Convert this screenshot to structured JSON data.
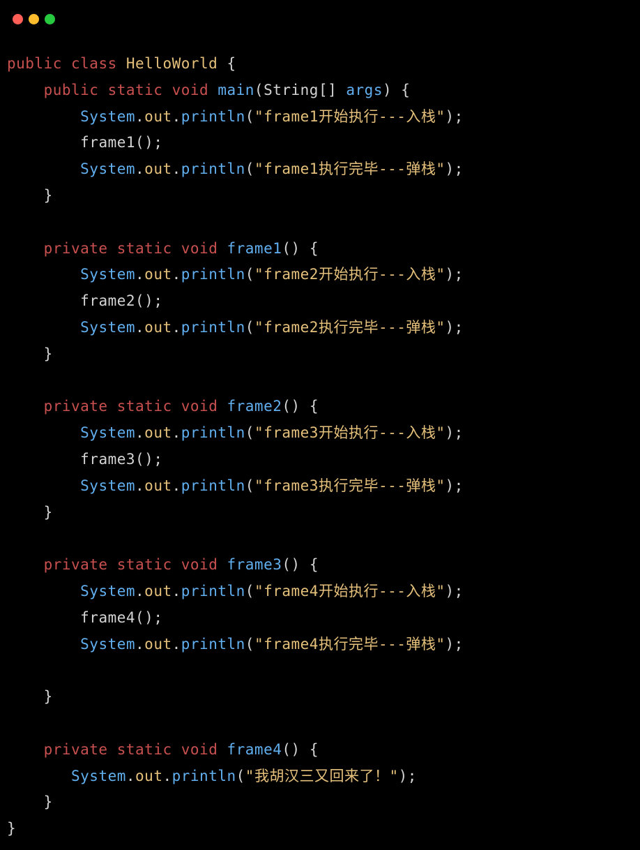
{
  "window": {
    "dots": [
      "red",
      "yellow",
      "green"
    ]
  },
  "tokens": {
    "public": "public",
    "private": "private",
    "class": "class",
    "static": "static",
    "void": "void",
    "className": "HelloWorld",
    "main": "main",
    "String": "String",
    "brackets": "[]",
    "args": "args",
    "System": "System",
    "out": "out",
    "println": "println",
    "frame1": "frame1",
    "frame2": "frame2",
    "frame3": "frame3",
    "frame4": "frame4",
    "lbrace": "{",
    "rbrace": "}",
    "lparen": "(",
    "rparen": ")",
    "parens": "()",
    "semi": ";",
    "dot": ".",
    "space": " "
  },
  "strings": {
    "s1a": "\"frame1开始执行---入栈\"",
    "s1b": "\"frame1执行完毕---弹栈\"",
    "s2a": "\"frame2开始执行---入栈\"",
    "s2b": "\"frame2执行完毕---弹栈\"",
    "s3a": "\"frame3开始执行---入栈\"",
    "s3b": "\"frame3执行完毕---弹栈\"",
    "s4a": "\"frame4开始执行---入栈\"",
    "s4b": "\"frame4执行完毕---弹栈\"",
    "s5": "\"我胡汉三又回来了！\""
  }
}
